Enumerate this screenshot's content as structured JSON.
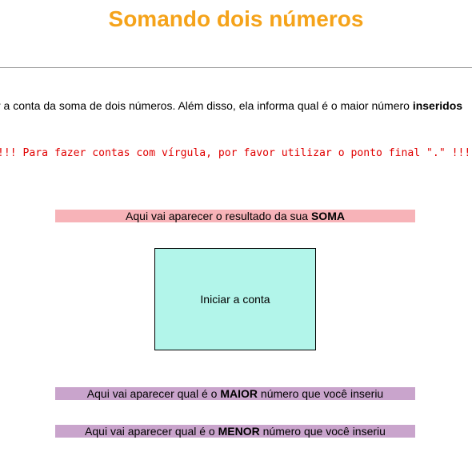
{
  "title": "Somando dois números",
  "intro": {
    "text_before": "r a conta da soma de dois números. Além disso, ela informa qual é o maior número ",
    "text_bold": "inseridos"
  },
  "warning": "!!! Para fazer contas com vírgula, por favor utilizar o ponto final \".\" !!!",
  "soma_result": {
    "prefix": "Aqui vai aparecer o resultado da sua ",
    "bold": "SOMA",
    "color": "#f7b3b8"
  },
  "start_button": {
    "label": "Iniciar a conta",
    "color": "#b2f5ea"
  },
  "maior_result": {
    "prefix": "Aqui vai aparecer qual é o ",
    "bold": "MAIOR",
    "suffix": " número que você inseriu",
    "color": "#c9a4cc"
  },
  "menor_result": {
    "prefix": "Aqui vai aparecer qual é o ",
    "bold": "MENOR",
    "suffix": " número que você inseriu",
    "color": "#c9a4cc"
  },
  "accent_color": "#f5a31a"
}
